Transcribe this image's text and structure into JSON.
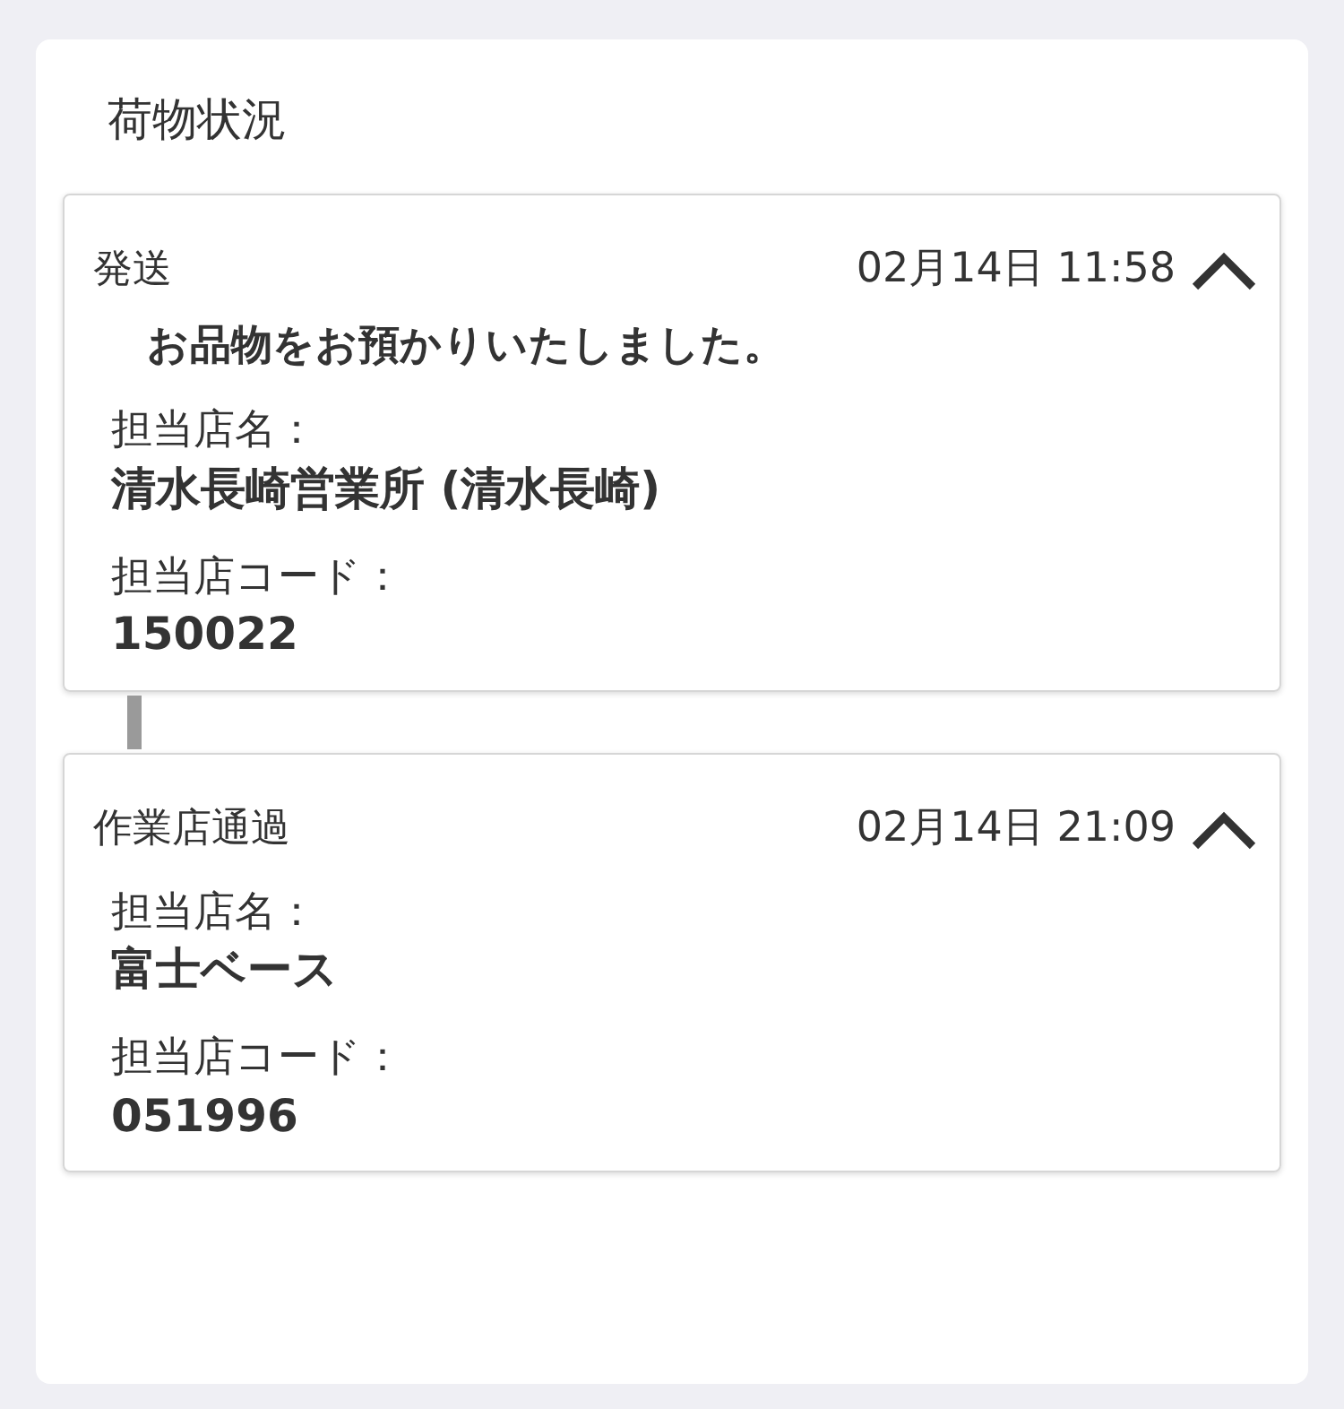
{
  "title": "荷物状況",
  "events": [
    {
      "status": "発送",
      "time": "02月14日 11:58",
      "expanded": true,
      "message": "お品物をお預かりいたしました。",
      "fields": [
        {
          "label": "担当店名：",
          "value": "清水長崎営業所 (清水長崎)"
        },
        {
          "label": "担当店コード：",
          "value": "150022"
        }
      ]
    },
    {
      "status": "作業店通過",
      "time": "02月14日 21:09",
      "expanded": true,
      "fields": [
        {
          "label": "担当店名：",
          "value": "富士ベース"
        },
        {
          "label": "担当店コード：",
          "value": "051996"
        }
      ]
    }
  ]
}
